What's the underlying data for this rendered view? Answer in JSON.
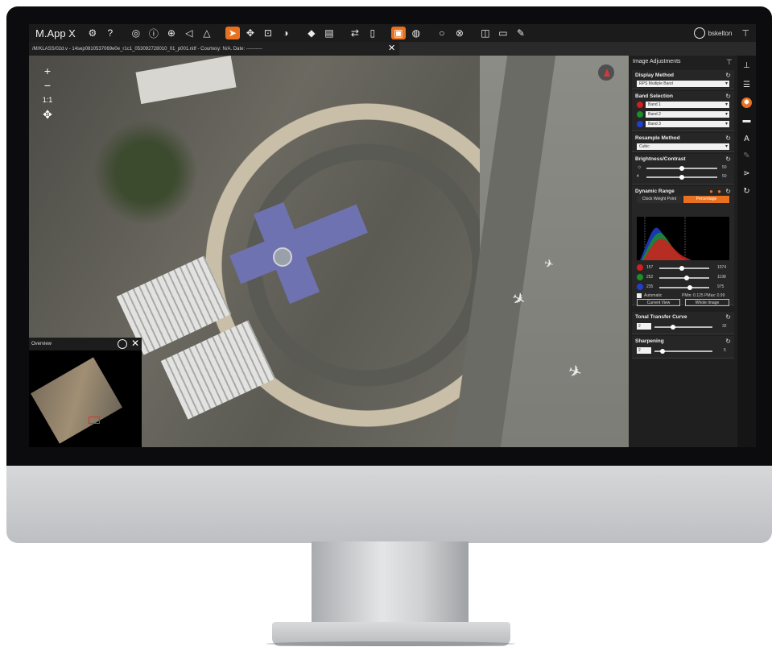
{
  "app": {
    "title": "M.App X",
    "user": "bskelton"
  },
  "tab": {
    "label": "/M/KLASS/02d.v - 14sep0810537069e0e_r1c1_053092728010_01_p001.nitf - Courtesy: N/A. Date: ----------"
  },
  "toolbar": {
    "icons": [
      "settings-icon",
      "help-icon",
      "layers-icon",
      "info-icon",
      "add-icon",
      "back-icon",
      "up-icon",
      "select-icon",
      "pan-icon",
      "zoom-box-icon",
      "half-circle-icon",
      "tag-icon",
      "stack-icon",
      "swap-icon",
      "dim-icon",
      "image-icon",
      "globe-icon",
      "circle-icon",
      "remove-icon",
      "split-icon",
      "window-icon",
      "pencil-icon"
    ],
    "active_color": "#e8711f"
  },
  "map": {
    "zoom_in": "+",
    "zoom_out": "−",
    "scale_label": "1:1",
    "pan": "✥"
  },
  "overview": {
    "title": "Overview"
  },
  "panel": {
    "title": "Image Adjustments",
    "display_method": {
      "label": "Display Method",
      "value": "RPS Multiple Band"
    },
    "band_selection": {
      "label": "Band Selection",
      "bands": [
        {
          "color": "#d11f1f",
          "value": "Band 1"
        },
        {
          "color": "#1a8f2a",
          "value": "Band 2"
        },
        {
          "color": "#1f3fd1",
          "value": "Band 3"
        }
      ]
    },
    "resample": {
      "label": "Resample Method",
      "value": "Cubic"
    },
    "brightness": {
      "label": "Brightness/Contrast",
      "brightness_value": "50",
      "contrast_value": "50",
      "brightness_pct": 0.5,
      "contrast_pct": 0.5
    },
    "dynamic": {
      "label": "Dynamic Range",
      "mode_a": "Clock Weight Point",
      "mode_b": "Percentage",
      "rows": [
        {
          "color": "#d11f1f",
          "low": "157",
          "high": "1074",
          "low_pct": 0.45,
          "high_pct": 0.95
        },
        {
          "color": "#1a8f2a",
          "low": "252",
          "high": "1198",
          "low_pct": 0.55,
          "high_pct": 0.9
        },
        {
          "color": "#1f3fd1",
          "low": "235",
          "high": "975",
          "low_pct": 0.62,
          "high_pct": 0.92
        }
      ],
      "automatic": "Automatic",
      "stats": "PMin: 0.125 PMax: 0.99",
      "btn_current": "Current View",
      "btn_whole": "Whole Image"
    },
    "tonal": {
      "label": "Tonal Transfer Curve",
      "select": "2",
      "value": "32",
      "pct": 0.3
    },
    "sharpening": {
      "label": "Sharpening",
      "select": "2",
      "value": "5",
      "pct": 0.1
    }
  },
  "strip": {
    "icons": [
      "ruler-icon",
      "list-icon",
      "sun-icon",
      "layers-dash-icon",
      "text-icon",
      "edit-icon",
      "share-icon",
      "rotate-icon"
    ]
  }
}
